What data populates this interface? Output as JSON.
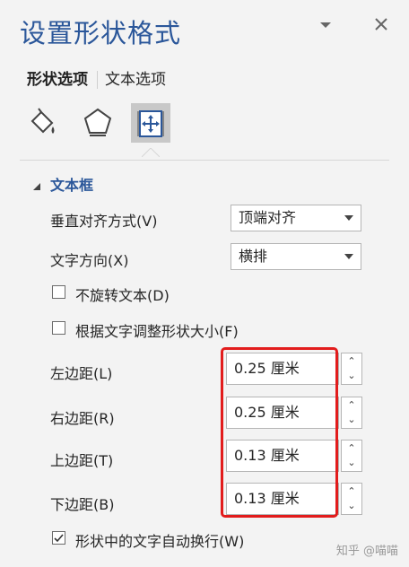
{
  "panel": {
    "title": "设置形状格式",
    "dropdown_icon": "chevron-down",
    "close_icon": "close"
  },
  "tabs": [
    {
      "label": "形状选项",
      "active": true
    },
    {
      "label": "文本选项",
      "active": false
    }
  ],
  "icons": [
    {
      "name": "fill-line-icon",
      "active": false
    },
    {
      "name": "effects-pentagon-icon",
      "active": false
    },
    {
      "name": "size-properties-icon",
      "active": true
    }
  ],
  "textbox": {
    "section_label": "文本框",
    "vertical_align": {
      "label": "垂直对齐方式(V)",
      "value": "顶端对齐"
    },
    "text_direction": {
      "label": "文字方向(X)",
      "value": "横排"
    },
    "no_rotate": {
      "label": "不旋转文本(D)",
      "checked": false
    },
    "autofit": {
      "label": "根据文字调整形状大小(F)",
      "checked": false
    },
    "margins": [
      {
        "label": "左边距(L)",
        "value": "0.25 厘米"
      },
      {
        "label": "右边距(R)",
        "value": "0.25 厘米"
      },
      {
        "label": "上边距(T)",
        "value": "0.13 厘米"
      },
      {
        "label": "下边距(B)",
        "value": "0.13 厘米"
      }
    ],
    "wrap_text": {
      "label": "形状中的文字自动换行(W)",
      "checked": true
    }
  },
  "highlight_color": "#e21c1c",
  "accent_color": "#2b579a",
  "watermark": "知乎 @喵喵"
}
